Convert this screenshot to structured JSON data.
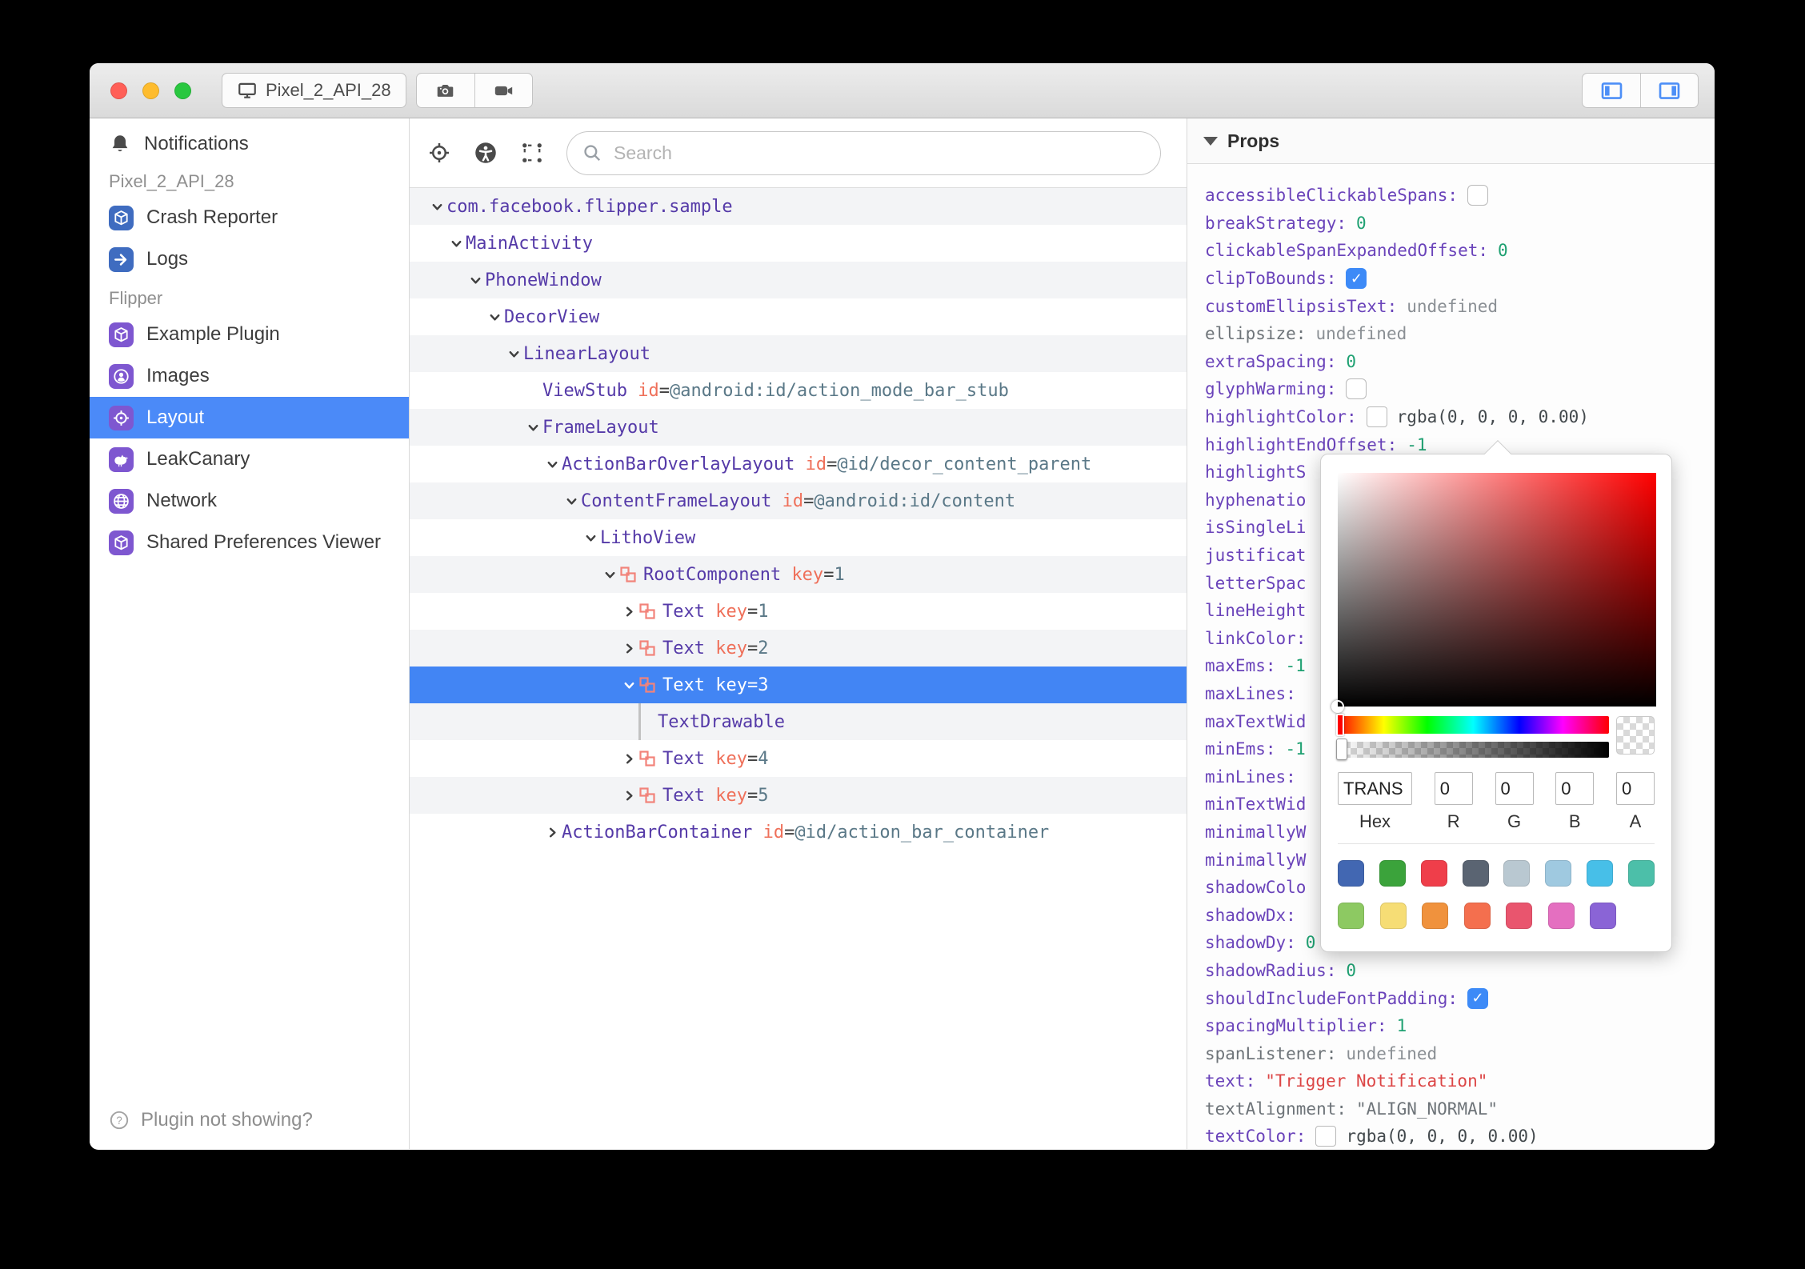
{
  "titlebar": {
    "tab_label": "Pixel_2_API_28",
    "tab_icon": "monitor-icon",
    "action_icons": [
      "camera-icon",
      "video-camera-icon"
    ],
    "panel_icons": [
      "panel-left-icon",
      "panel-right-icon"
    ],
    "traffic_lights": [
      "close",
      "minimize",
      "zoom"
    ]
  },
  "sidebar": {
    "notifications": {
      "label": "Notifications",
      "icon": "bell-icon"
    },
    "sections": [
      {
        "header": "Pixel_2_API_28",
        "items": [
          {
            "label": "Crash Reporter",
            "icon": "cube-icon",
            "icon_bg": "#3f6cc0",
            "selected": false
          },
          {
            "label": "Logs",
            "icon": "arrow-right-icon",
            "icon_bg": "#3f6cc0",
            "selected": false
          }
        ]
      },
      {
        "header": "Flipper",
        "items": [
          {
            "label": "Example Plugin",
            "icon": "cube-icon",
            "icon_bg": "#7e57d0",
            "selected": false
          },
          {
            "label": "Images",
            "icon": "person-icon",
            "icon_bg": "#7e57d0",
            "selected": false
          },
          {
            "label": "Layout",
            "icon": "target-icon",
            "icon_bg": "#7e57d0",
            "selected": true
          },
          {
            "label": "LeakCanary",
            "icon": "bird-icon",
            "icon_bg": "#7e57d0",
            "selected": false
          },
          {
            "label": "Network",
            "icon": "globe-icon",
            "icon_bg": "#7e57d0",
            "selected": false
          },
          {
            "label": "Shared Preferences Viewer",
            "icon": "cube-icon",
            "icon_bg": "#7e57d0",
            "selected": false
          }
        ]
      }
    ],
    "footer": {
      "label": "Plugin not showing?",
      "icon": "question-circle-icon"
    }
  },
  "inspector": {
    "toolbar_icons": [
      "target-icon",
      "accessibility-icon",
      "layout-bounds-icon"
    ],
    "search": {
      "placeholder": "Search",
      "value": "",
      "icon": "search-icon"
    },
    "tree": [
      {
        "name": "com.facebook.flipper.sample",
        "level": 0,
        "state": "expanded"
      },
      {
        "name": "MainActivity",
        "level": 1,
        "state": "expanded"
      },
      {
        "name": "PhoneWindow",
        "level": 2,
        "state": "expanded"
      },
      {
        "name": "DecorView",
        "level": 3,
        "state": "expanded"
      },
      {
        "name": "LinearLayout",
        "level": 4,
        "state": "expanded"
      },
      {
        "name": "ViewStub",
        "level": 5,
        "state": "leaf",
        "attr_key": "id",
        "attr_value": "@android:id/action_mode_bar_stub"
      },
      {
        "name": "FrameLayout",
        "level": 5,
        "state": "expanded"
      },
      {
        "name": "ActionBarOverlayLayout",
        "level": 6,
        "state": "expanded",
        "attr_key": "id",
        "attr_value": "@id/decor_content_parent"
      },
      {
        "name": "ContentFrameLayout",
        "level": 7,
        "state": "expanded",
        "attr_key": "id",
        "attr_value": "@android:id/content"
      },
      {
        "name": "LithoView",
        "level": 8,
        "state": "expanded"
      },
      {
        "name": "RootComponent",
        "level": 9,
        "state": "expanded",
        "litho": true,
        "attr_key": "key",
        "attr_value": "1"
      },
      {
        "name": "Text",
        "level": 10,
        "state": "collapsed",
        "litho": true,
        "attr_key": "key",
        "attr_value": "1"
      },
      {
        "name": "Text",
        "level": 10,
        "state": "collapsed",
        "litho": true,
        "attr_key": "key",
        "attr_value": "2"
      },
      {
        "name": "Text",
        "level": 10,
        "state": "expanded",
        "litho": true,
        "attr_key": "key",
        "attr_value": "3",
        "selected": true
      },
      {
        "name": "TextDrawable",
        "level": 11,
        "state": "guide"
      },
      {
        "name": "Text",
        "level": 10,
        "state": "collapsed",
        "litho": true,
        "attr_key": "key",
        "attr_value": "4"
      },
      {
        "name": "Text",
        "level": 10,
        "state": "collapsed",
        "litho": true,
        "attr_key": "key",
        "attr_value": "5"
      },
      {
        "name": "ActionBarContainer",
        "level": 6,
        "state": "collapsed",
        "attr_key": "id",
        "attr_value": "@id/action_bar_container"
      }
    ]
  },
  "props": {
    "header": "Props",
    "rows": [
      {
        "label": "accessibleClickableSpans:",
        "type": "check-off"
      },
      {
        "label": "breakStrategy:",
        "type": "num",
        "value": "0"
      },
      {
        "label": "clickableSpanExpandedOffset:",
        "type": "num",
        "value": "0"
      },
      {
        "label": "clipToBounds:",
        "type": "check-on"
      },
      {
        "label": "customEllipsisText:",
        "type": "undef",
        "value": "undefined"
      },
      {
        "label": "ellipsize:",
        "gray": true,
        "type": "undef",
        "value": "undefined"
      },
      {
        "label": "extraSpacing:",
        "type": "num",
        "value": "0"
      },
      {
        "label": "glyphWarming:",
        "type": "check-off"
      },
      {
        "label": "highlightColor:",
        "type": "swatch",
        "value": "rgba(0, 0, 0, 0.00)"
      },
      {
        "label": "highlightEndOffset:",
        "type": "num",
        "value": "-1"
      },
      {
        "label": "highlightS",
        "type": "none"
      },
      {
        "label": "hyphenatio",
        "type": "none"
      },
      {
        "label": "isSingleLi",
        "type": "none"
      },
      {
        "label": "justificat",
        "type": "none"
      },
      {
        "label": "letterSpac",
        "type": "none"
      },
      {
        "label": "lineHeight",
        "type": "none"
      },
      {
        "label": "linkColor:",
        "type": "none"
      },
      {
        "label": "maxEms:",
        "type": "num",
        "value": "-1"
      },
      {
        "label": "maxLines:",
        "type": "none"
      },
      {
        "label": "maxTextWid",
        "type": "none"
      },
      {
        "label": "minEms:",
        "type": "num",
        "value": "-1"
      },
      {
        "label": "minLines:",
        "type": "none"
      },
      {
        "label": "minTextWid",
        "type": "none"
      },
      {
        "label": "minimallyW",
        "type": "none"
      },
      {
        "label": "minimallyW",
        "type": "none"
      },
      {
        "label": "shadowColo",
        "type": "none"
      },
      {
        "label": "shadowDx:",
        "type": "none"
      },
      {
        "label": "shadowDy:",
        "type": "num",
        "value": "0"
      },
      {
        "label": "shadowRadius:",
        "type": "num",
        "value": "0"
      },
      {
        "label": "shouldIncludeFontPadding:",
        "type": "check-on"
      },
      {
        "label": "spacingMultiplier:",
        "type": "num",
        "value": "1"
      },
      {
        "label": "spanListener:",
        "gray": true,
        "type": "undef",
        "value": "undefined"
      },
      {
        "label": "text:",
        "type": "str",
        "value": "\"Trigger Notification\""
      },
      {
        "label": "textAlignment:",
        "gray": true,
        "type": "str-gray",
        "value": "\"ALIGN_NORMAL\""
      },
      {
        "label": "textColor:",
        "type": "swatch",
        "value": "rgba(0, 0, 0, 0.00)"
      }
    ]
  },
  "color_picker": {
    "hex": "TRANS",
    "r": "0",
    "g": "0",
    "b": "0",
    "a": "0",
    "labels": {
      "hex": "Hex",
      "r": "R",
      "g": "G",
      "b": "B",
      "a": "A"
    },
    "swatches_row1": [
      "#4267B2",
      "#3BA33B",
      "#EF3E4A",
      "#5A6472",
      "#B9C8D1",
      "#9FC9E0",
      "#47BFE8",
      "#4CBFA9"
    ],
    "swatches_row2": [
      "#8DC962",
      "#F6DD75",
      "#F0923D",
      "#F46F4E",
      "#E9556E",
      "#E46FC0",
      "#8A64D6"
    ]
  },
  "colors": {
    "sidebar_selection": "#4b8af8",
    "tree_selection": "#4285f4",
    "tree_node_purple": "#553aa8",
    "tree_attr_salmon": "#ef705a",
    "tree_attr_value": "#5a7887",
    "prop_label_purple": "#6a43ba",
    "prop_number_teal": "#1fa172",
    "prop_string_red": "#dc4646",
    "litho_icon_salmon": "#f2837a",
    "plugin_icon_blue": "#3f6cc0",
    "plugin_icon_purple": "#7e57d0",
    "checkbox_blue": "#3d8af7"
  }
}
